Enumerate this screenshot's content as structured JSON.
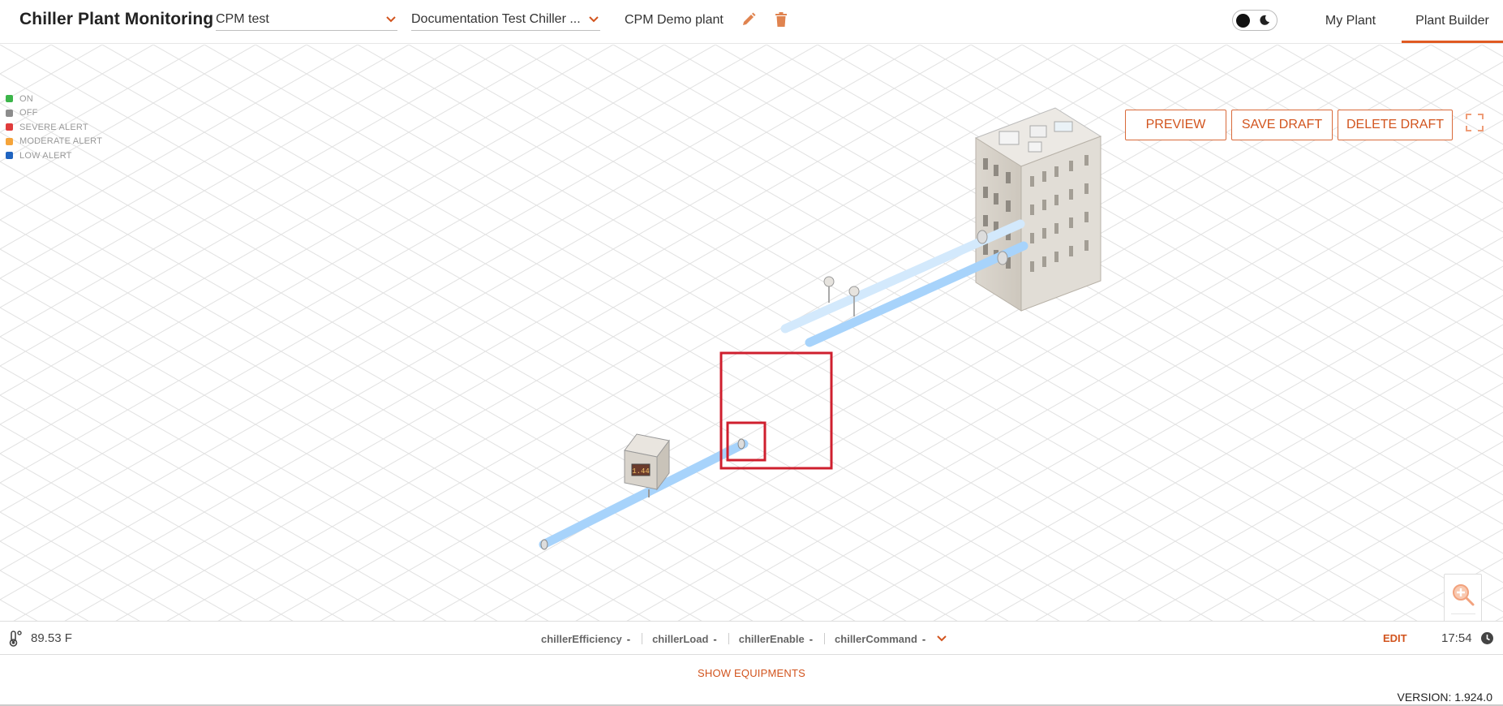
{
  "header": {
    "app_title": "Chiller Plant Monitoring",
    "plant_select": "CPM test",
    "chiller_select": "Documentation Test Chiller ...",
    "plant_name": "CPM Demo plant",
    "nav": {
      "my_plant": "My Plant",
      "plant_builder": "Plant Builder"
    },
    "active_tab": "Plant Builder"
  },
  "legend": [
    {
      "label": "ON",
      "color": "#3cb54a"
    },
    {
      "label": "OFF",
      "color": "#8c8c8c"
    },
    {
      "label": "SEVERE ALERT",
      "color": "#e03c3c"
    },
    {
      "label": "MODERATE ALERT",
      "color": "#f5a43a"
    },
    {
      "label": "LOW ALERT",
      "color": "#1f64c0"
    }
  ],
  "actions": {
    "preview": "PREVIEW",
    "save_draft": "SAVE DRAFT",
    "delete_draft": "DELETE DRAFT"
  },
  "device_display": "1.44",
  "status": {
    "temperature": "89.53 F",
    "params": [
      {
        "name": "chillerEfficiency",
        "value": "-"
      },
      {
        "name": "chillerLoad",
        "value": "-"
      },
      {
        "name": "chillerEnable",
        "value": "-"
      },
      {
        "name": "chillerCommand",
        "value": "-"
      }
    ],
    "edit": "EDIT",
    "time": "17:54"
  },
  "show_equipments": "SHOW EQUIPMENTS",
  "version": "VERSION: 1.924.0",
  "colors": {
    "accent": "#d2541e",
    "pipe": "#a7d3fb",
    "pipe_light": "#d3e9fc",
    "selection": "#cf1f2e"
  }
}
